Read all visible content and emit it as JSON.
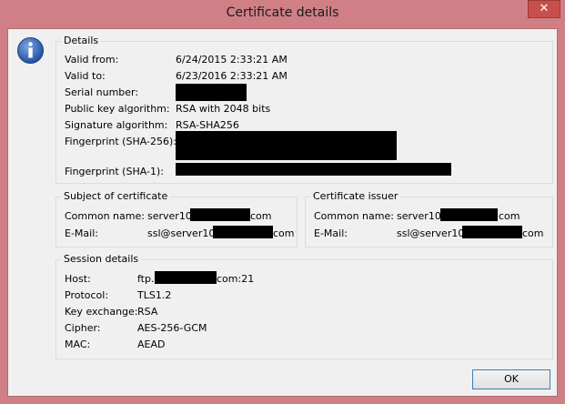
{
  "window": {
    "title": "Certificate details",
    "close_glyph": "✕"
  },
  "details": {
    "group_title": "Details",
    "valid_from_label": "Valid from:",
    "valid_from": "6/24/2015 2:33:21 AM",
    "valid_to_label": "Valid to:",
    "valid_to": "6/23/2016 2:33:21 AM",
    "serial_label": "Serial number:",
    "pubkey_label": "Public key algorithm:",
    "pubkey": "RSA with 2048 bits",
    "sigalg_label": "Signature algorithm:",
    "sigalg": "RSA-SHA256",
    "fp256_label": "Fingerprint (SHA-256):",
    "fp1_label": "Fingerprint (SHA-1):"
  },
  "subject": {
    "group_title": "Subject of certificate",
    "cn_label": "Common name:",
    "cn_prefix": "server10",
    "cn_suffix": "com",
    "email_label": "E-Mail:",
    "email_prefix": "ssl@server10.",
    "email_suffix": "com"
  },
  "issuer": {
    "group_title": "Certificate issuer",
    "cn_label": "Common name:",
    "cn_prefix": "server10.",
    "cn_suffix": "com",
    "email_label": "E-Mail:",
    "email_prefix": "ssl@server10.",
    "email_suffix": "com"
  },
  "session": {
    "group_title": "Session details",
    "host_label": "Host:",
    "host_prefix": "ftp.",
    "host_suffix": "com:21",
    "protocol_label": "Protocol:",
    "protocol": "TLS1.2",
    "kex_label": "Key exchange:",
    "kex": "RSA",
    "cipher_label": "Cipher:",
    "cipher": "AES-256-GCM",
    "mac_label": "MAC:",
    "mac": "AEAD"
  },
  "buttons": {
    "ok": "OK"
  },
  "colors": {
    "titlebar": "#d07f86",
    "close": "#c7504c",
    "icon": "#2f62b5"
  },
  "icons": {
    "info": "info-icon"
  }
}
